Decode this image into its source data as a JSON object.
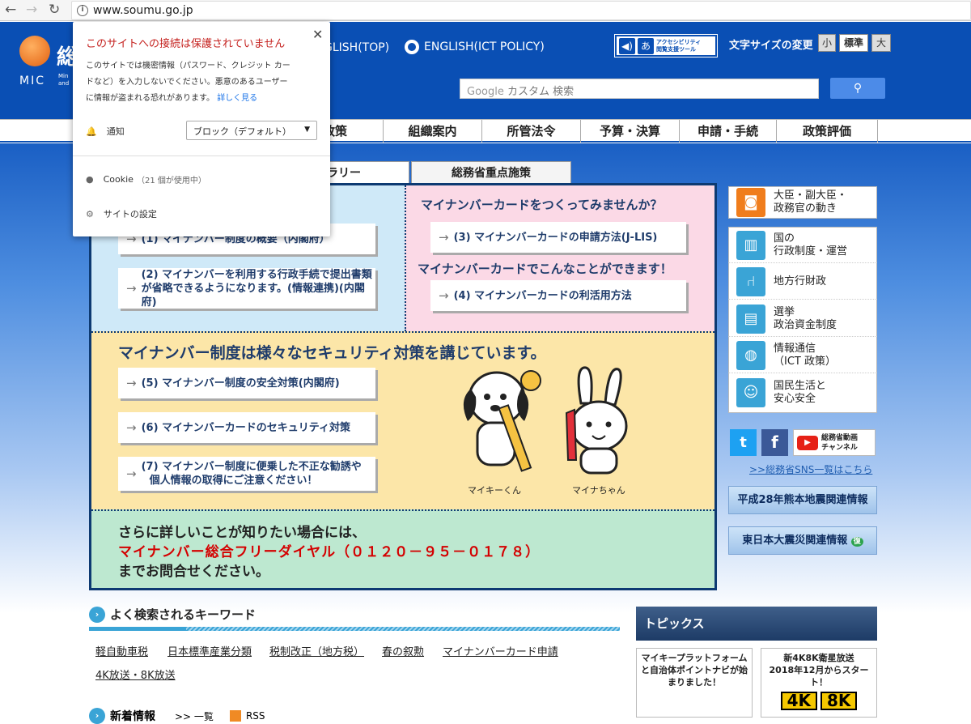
{
  "browser": {
    "url": "www.soumu.go.jp"
  },
  "header": {
    "logo_kanji": "総",
    "logo_abbr": "MIC",
    "logo_small1": "Min",
    "logo_small2": "and",
    "english_top": "GLISH(TOP)",
    "english_ict": "ENGLISH(ICT POLICY)",
    "accessibility_line1": "アクセシビリティ",
    "accessibility_line2": "閲覧支援ツール",
    "font_size_label": "文字サイズの変更",
    "font_small": "小",
    "font_standard": "標準",
    "font_large": "大",
    "search_placeholder": "カスタム 検索",
    "search_brand": "Google"
  },
  "nav": {
    "items": [
      "政策",
      "組織案内",
      "所管法令",
      "予算・決算",
      "申請・手続",
      "政策評価"
    ]
  },
  "tabs": [
    "ャラリー",
    "総務省重点施策"
  ],
  "panel": {
    "left_items": [
      "(1) マイナンバー制度の概要（内閣府）",
      "(2) マイナンバーを利用する行政手続で提出書類",
      "が省略できるようになります。(情報連携)(内閣府)"
    ],
    "right_heading": "マイナンバーカードをつくってみませんか？",
    "right_item1": "(3) マイナンバーカードの申請方法(J-LIS)",
    "right_heading2": "マイナンバーカードでこんなことができます！",
    "right_item2": "(4) マイナンバーカードの利活用方法",
    "mid_heading": "マイナンバー制度は様々なセキュリティ対策を講じています。",
    "mid_item5": "(5) マイナンバー制度の安全対策(内閣府)",
    "mid_item6": "(6) マイナンバーカードのセキュリティ対策",
    "mid_item7a": "(7) マイナンバー制度に便乗した不正な勧誘や",
    "mid_item7b": "個人情報の取得にご注意ください！",
    "char1": "マイキーくん",
    "char2": "マイナちゃん",
    "bottom1": "さらに詳しいことが知りたい場合には、",
    "bottom2": "マイナンバー総合フリーダイヤル（０１２０－９５－０１７８）",
    "bottom3": "までお問合せください。"
  },
  "sidebar": {
    "items": [
      {
        "icon": "camera-icon",
        "line1": "大臣・副大臣・",
        "line2": "政務官の動き"
      },
      {
        "icon": "government-building-icon",
        "line1": "国の",
        "line2": "行政制度・運営"
      },
      {
        "icon": "chair-icon",
        "line1": "地方行財政",
        "line2": ""
      },
      {
        "icon": "ballot-box-icon",
        "line1": "選挙",
        "line2": "政治資金制度"
      },
      {
        "icon": "globe-icon",
        "line1": "情報通信",
        "line2": "（ICT 政策）"
      },
      {
        "icon": "people-icon",
        "line1": "国民生活と",
        "line2": "安心安全"
      }
    ],
    "sns_video1": "総務省動画",
    "sns_video2": "チャンネル",
    "sns_link": ">>総務省SNS一覧はこちら",
    "banner1": "平成28年熊本地震関連情報",
    "banner2": "東日本大震災関連情報",
    "banner2_badge": "復"
  },
  "keywords": {
    "heading": "よく検索されるキーワード",
    "items": [
      "軽自動車税",
      "日本標準産業分類",
      "税制改正（地方税）",
      "春の叙勲",
      "マイナンバーカード申請",
      "4K放送・8K放送"
    ]
  },
  "topics": {
    "heading": "トピックス",
    "card1_line1": "マイキープラットフォーム",
    "card1_line2": "と自治体ポイントナビが始",
    "card1_line3": "まりました！",
    "card2_line1": "新4K8K衛星放送",
    "card2_line2": "2018年12月からスタート！",
    "card2_4k": "4K",
    "card2_8k": "8K"
  },
  "news": {
    "heading": "新着情報",
    "list_link": ">> 一覧",
    "rss": "RSS"
  },
  "popup": {
    "title": "このサイトへの接続は保護されていません",
    "desc1": "このサイトでは機密情報（パスワード、クレジット カー",
    "desc2": "ドなど）を入力しないでください。悪意のあるユーザー",
    "desc3": "に情報が盗まれる恐れがあります。",
    "learn_more": "詳しく見る",
    "notif_label": "通知",
    "notif_value": "ブロック（デフォルト）",
    "cookie_label": "Cookie",
    "cookie_count": "（21 個が使用中）",
    "site_settings": "サイトの設定"
  }
}
